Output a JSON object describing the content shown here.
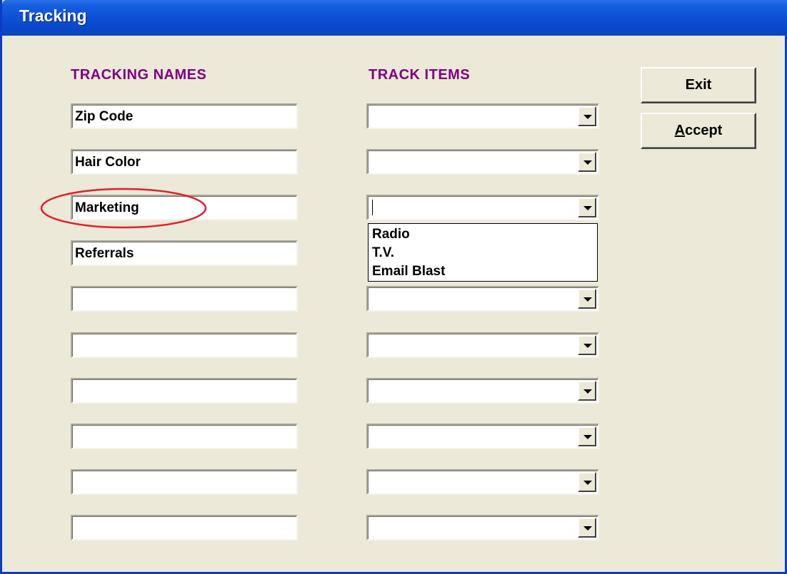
{
  "window": {
    "title": "Tracking"
  },
  "headers": {
    "names": "TRACKING NAMES",
    "items": "TRACK ITEMS"
  },
  "tracking_names": [
    "Zip Code",
    "Hair Color",
    "Marketing",
    "Referrals",
    "",
    "",
    "",
    "",
    "",
    ""
  ],
  "track_items": [
    "",
    "",
    "",
    "",
    "",
    "",
    "",
    "",
    "",
    ""
  ],
  "dropdown": {
    "open_row": 3,
    "options": [
      "Radio",
      "T.V.",
      "Email Blast"
    ]
  },
  "buttons": {
    "exit": "Exit",
    "accept_accel": "A",
    "accept_rest": "ccept"
  },
  "colors": {
    "title_bar": "#0a46c8",
    "header_text": "#800080",
    "annotation": "#e0202a",
    "window_bg": "#ece9d8"
  }
}
